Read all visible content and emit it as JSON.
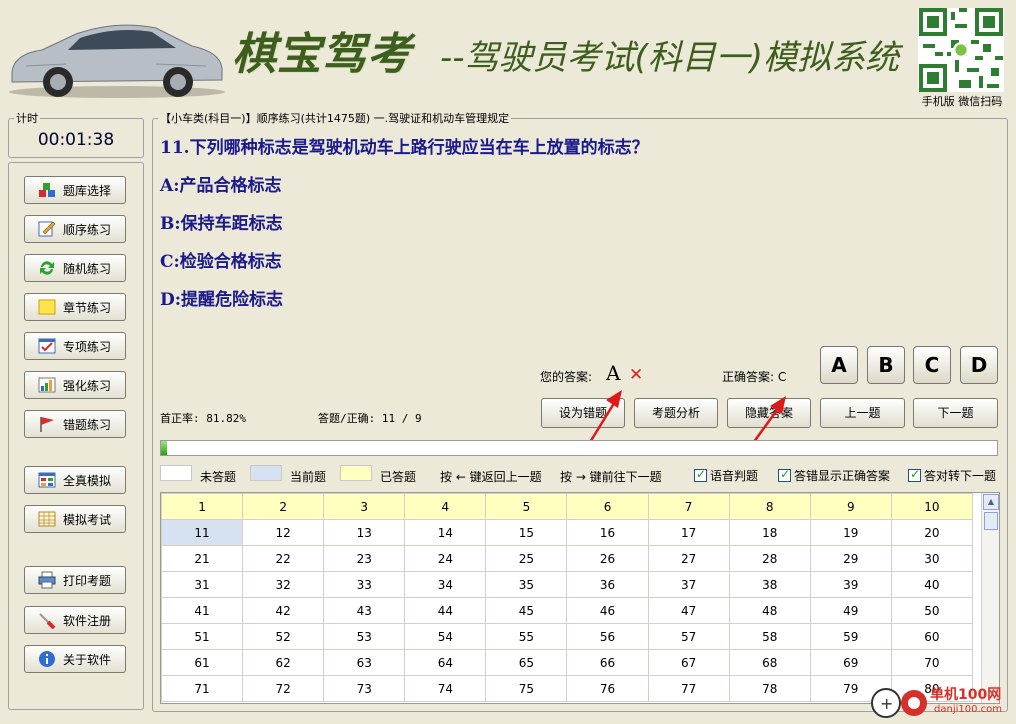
{
  "header": {
    "brand": "棋宝驾考",
    "subtitle": "--驾驶员考试(科目一)模拟系统",
    "qr_caption": "手机版 微信扫码"
  },
  "timer": {
    "label": "计时",
    "value": "00:01:38"
  },
  "nav": {
    "items": [
      {
        "label": "题库选择",
        "icon": "cubes-icon"
      },
      {
        "label": "顺序练习",
        "icon": "pencil-note-icon"
      },
      {
        "label": "随机练习",
        "icon": "refresh-arrows-icon"
      },
      {
        "label": "章节练习",
        "icon": "sticky-note-icon"
      },
      {
        "label": "专项练习",
        "icon": "checklist-icon"
      },
      {
        "label": "强化练习",
        "icon": "bar-chart-icon"
      },
      {
        "label": "错题练习",
        "icon": "flag-icon"
      },
      {
        "label": "全真模拟",
        "icon": "window-grid-icon"
      },
      {
        "label": "模拟考试",
        "icon": "calendar-table-icon"
      },
      {
        "label": "打印考题",
        "icon": "printer-icon"
      },
      {
        "label": "软件注册",
        "icon": "screwdriver-icon"
      },
      {
        "label": "关于软件",
        "icon": "info-icon"
      }
    ]
  },
  "main": {
    "breadcrumb": "【小车类(科目一)】顺序练习(共计1475题) 一.驾驶证和机动车管理规定",
    "question": "11.下列哪种标志是驾驶机动车上路行驶应当在车上放置的标志？",
    "options": [
      "A:产品合格标志",
      "B:保持车距标志",
      "C:检验合格标志",
      "D:提醒危险标志"
    ],
    "your_answer_label": "您的答案:",
    "your_answer": "A",
    "wrong_mark": "✕",
    "correct_answer_label": "正确答案: C",
    "answer_buttons": [
      "A",
      "B",
      "C",
      "D"
    ],
    "accuracy": "首正率: 81.82%",
    "answered": "答题/正确: 11 / 9",
    "actions": [
      "设为错题",
      "考题分析",
      "隐藏答案",
      "上一题",
      "下一题"
    ],
    "progress": 0.007,
    "legend": {
      "unanswered": "未答题",
      "current": "当前题",
      "answered": "已答题",
      "unanswered_color": "#FFFFFF",
      "current_color": "#D6E1F2",
      "answered_color": "#FFFFC0"
    },
    "hints": {
      "back": "按 ← 键返回上一题",
      "forward": "按 → 键前往下一题"
    },
    "checkboxes": [
      "语音判题",
      "答错显示正确答案",
      "答对转下一题"
    ],
    "grid": [
      [
        "1",
        "2",
        "3",
        "4",
        "5",
        "6",
        "7",
        "8",
        "9",
        "10"
      ],
      [
        "11",
        "12",
        "13",
        "14",
        "15",
        "16",
        "17",
        "18",
        "19",
        "20"
      ],
      [
        "21",
        "22",
        "23",
        "24",
        "25",
        "26",
        "27",
        "28",
        "29",
        "30"
      ],
      [
        "31",
        "32",
        "33",
        "34",
        "35",
        "36",
        "37",
        "38",
        "39",
        "40"
      ],
      [
        "41",
        "42",
        "43",
        "44",
        "45",
        "46",
        "47",
        "48",
        "49",
        "50"
      ],
      [
        "51",
        "52",
        "53",
        "54",
        "55",
        "56",
        "57",
        "58",
        "59",
        "60"
      ],
      [
        "61",
        "62",
        "63",
        "64",
        "65",
        "66",
        "67",
        "68",
        "69",
        "70"
      ],
      [
        "71",
        "72",
        "73",
        "74",
        "75",
        "76",
        "77",
        "78",
        "79",
        "80"
      ]
    ]
  },
  "watermark": {
    "line1": "单机100网",
    "line2": "danji100.com"
  }
}
